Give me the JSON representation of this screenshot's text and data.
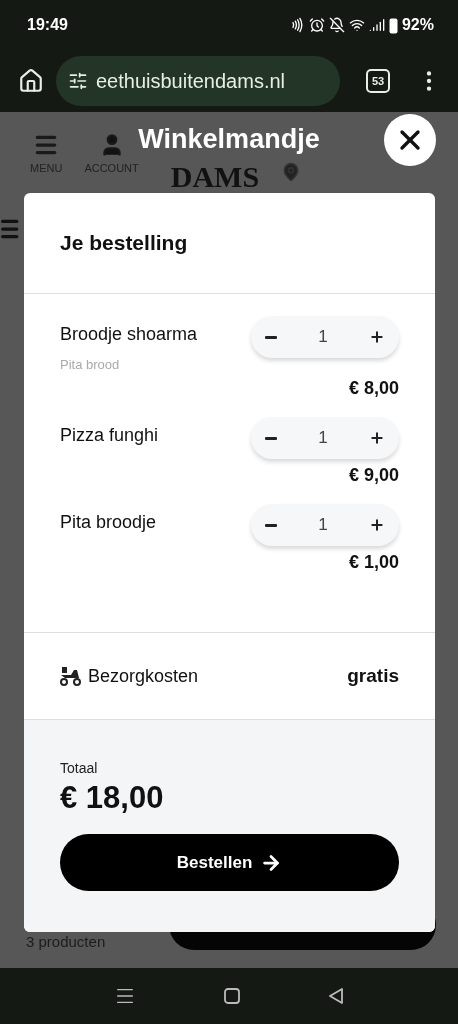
{
  "status_bar": {
    "time": "19:49",
    "battery": "92%"
  },
  "browser": {
    "url": "eethuisbuitendams.nl",
    "tab_count": "53"
  },
  "page": {
    "header_items": [
      {
        "label": "MENU",
        "kind": "menu"
      },
      {
        "label": "ACCOUNT",
        "kind": "account"
      }
    ],
    "logo": "DAMS",
    "product_count": "3 producten"
  },
  "cart": {
    "title": "Winkelmandje",
    "heading": "Je bestelling",
    "items": [
      {
        "name": "Broodje shoarma",
        "note": "Pita brood",
        "quantity": "1",
        "price": "€ 8,00"
      },
      {
        "name": "Pizza funghi",
        "quantity": "1",
        "price": "€ 9,00"
      },
      {
        "name": "Pita broodje",
        "quantity": "1",
        "price": "€ 1,00"
      }
    ],
    "delivery": {
      "label": "Bezorgkosten",
      "value": "gratis"
    },
    "total_label": "Totaal",
    "total": "€ 18,00",
    "order_button": "Bestellen"
  }
}
